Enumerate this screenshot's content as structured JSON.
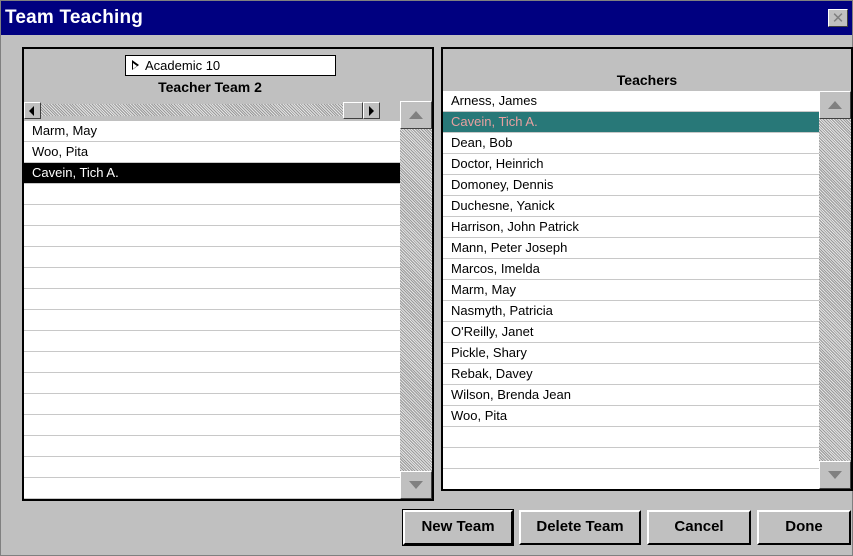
{
  "window": {
    "title": "Team Teaching"
  },
  "left_panel": {
    "group_selector": "Academic 10",
    "header": "Teacher Team 2",
    "members": [
      "Marm, May",
      "Woo, Pita",
      "Cavein, Tich A."
    ],
    "selected_index": 2
  },
  "right_panel": {
    "header": "Teachers",
    "teachers": [
      "Arness, James",
      "Cavein, Tich A.",
      "Dean, Bob",
      "Doctor, Heinrich",
      "Domoney, Dennis",
      "Duchesne, Yanick",
      "Harrison, John Patrick",
      "Mann, Peter Joseph",
      "Marcos, Imelda",
      "Marm, May",
      "Nasmyth, Patricia",
      "O'Reilly, Janet",
      "Pickle, Shary",
      "Rebak, Davey",
      "Wilson, Brenda Jean",
      "Woo, Pita"
    ],
    "selected_index": 1
  },
  "buttons": {
    "new_team": "New Team",
    "delete_team": "Delete Team",
    "cancel": "Cancel",
    "done": "Done"
  },
  "colors": {
    "title_bar": "#000080",
    "selection_black": "#000000",
    "selection_teal": "#287878",
    "selection_teal_text": "#e8a0a0"
  }
}
